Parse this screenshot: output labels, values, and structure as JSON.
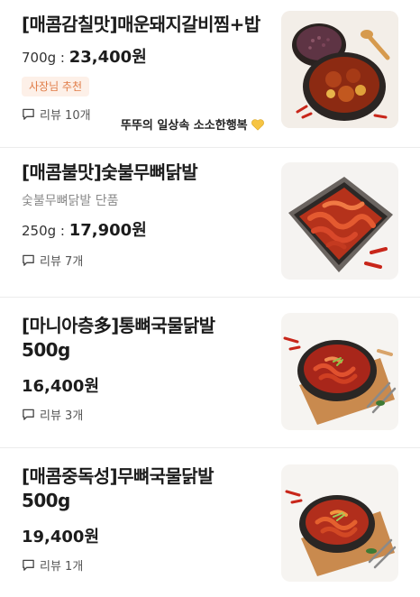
{
  "items": [
    {
      "name": "[매콤감칠맛]매운돼지갈비찜+밥",
      "weight": "700g : ",
      "price": "23,400원",
      "badge": "사장님 추천",
      "review": "리뷰 10개",
      "owner_comment": "뚜뚜의 일상속 소소한행복"
    },
    {
      "name": "[매콤불맛]숯불무뼈닭발",
      "description": "숯불무뼈닭발 단품",
      "weight": "250g : ",
      "price": "17,900원",
      "review": "리뷰 7개"
    },
    {
      "name": "[마니아층多]통뼈국물닭발 500g",
      "price": "16,400원",
      "review": "리뷰 3개"
    },
    {
      "name": "[매콤중독성]무뼈국물닭발 500g",
      "price": "19,400원",
      "review": "리뷰 1개"
    }
  ],
  "icons": {
    "review": "speech-bubble-icon",
    "heart": "yellow-heart-icon"
  },
  "colors": {
    "badge_bg": "#fdf0e8",
    "badge_text": "#e07b46",
    "heart": "#f6c443"
  }
}
